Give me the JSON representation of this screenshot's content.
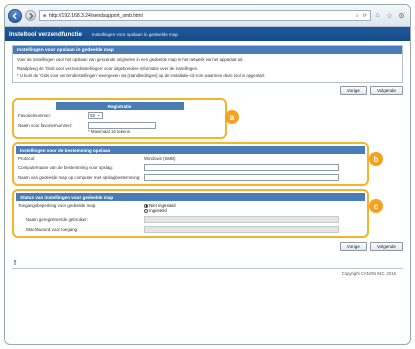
{
  "browser": {
    "url": "http://192.168.3.24/sendsupport_smb.html",
    "home_icon": "home-icon",
    "star_icon": "star-icon",
    "gear_icon": "gear-icon"
  },
  "header": {
    "app_title": "Insteltool verzendfunctie",
    "page_title": "Instellingen voor opslaan in gedeelde map"
  },
  "intro": {
    "title": "Instellingen voor opslaan in gedeelde map",
    "line1": "Voer de instellingen voor het opslaan van gescande originelen in een gedeelde map in het netwerk via het apparaat uit.",
    "line2": "Raadpleeg de 'Gids voor verzendinstellingen' voor uitgebreidere informatie over de instellingen.",
    "line3": "* U kunt de 'Gids voor verzendinstellingen' weergeven via [Handleidingen] op de installatie-cd-rom waarmee deze tool is opgestart."
  },
  "buttons": {
    "previous": "Vorige",
    "next": "Volgende"
  },
  "registration": {
    "title": "Registratie",
    "favorite_label": "Favorietnummer:",
    "favorite_value": "02",
    "name_label": "Naam voor favorietnummer:",
    "name_value": "",
    "max_hint": "* Maximaal 16 tekens",
    "badge": "a"
  },
  "destination": {
    "title": "Instellingen voor de bestemming opslaan",
    "protocol_label": "Protocol:",
    "protocol_value": "Windows (SMB)",
    "computer_label": "Computernaam van de bestemming voor opslag:",
    "folder_label": "Naam van gedeelde map op computer met opslagbestemming:",
    "badge": "b"
  },
  "access": {
    "title": "Status van instellingen voor gedeelde map",
    "restriction_label": "Toegangsbeperking voor gedeelde map:",
    "option_not_set": "Niet ingesteld",
    "option_set": "Ingesteld",
    "username_label": "Naam geregistreerde gebruiker:",
    "password_label": "Wachtwoord voor toegang:",
    "badge": "c"
  },
  "footer": {
    "copyright": "Copyright CANON INC. 2015"
  }
}
